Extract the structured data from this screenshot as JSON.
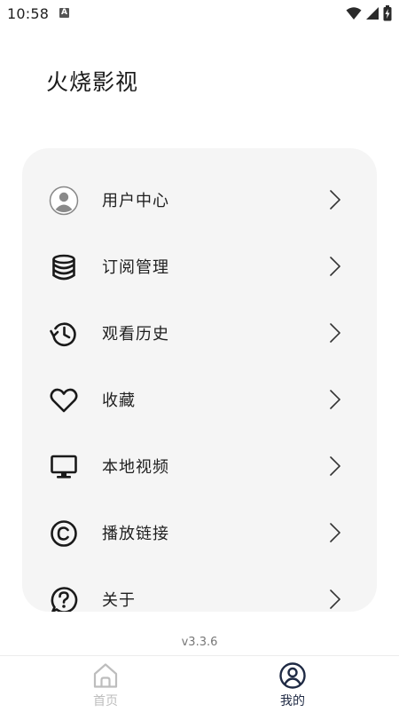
{
  "status_bar": {
    "time": "10:58",
    "notification_glyph": "A"
  },
  "header": {
    "app_title": "火烧影视"
  },
  "menu": {
    "items": [
      {
        "label": "用户中心",
        "icon": "user-avatar-icon"
      },
      {
        "label": "订阅管理",
        "icon": "database-icon"
      },
      {
        "label": "观看历史",
        "icon": "history-icon"
      },
      {
        "label": "收藏",
        "icon": "heart-icon"
      },
      {
        "label": "本地视频",
        "icon": "monitor-icon"
      },
      {
        "label": "播放链接",
        "icon": "copyright-icon"
      },
      {
        "label": "关于",
        "icon": "help-icon"
      }
    ]
  },
  "footer": {
    "version": "v3.3.6"
  },
  "bottom_nav": {
    "home_label": "首页",
    "mine_label": "我的",
    "active": "mine"
  },
  "colors": {
    "card_bg": "#f5f5f5",
    "active_nav": "#1f2a44",
    "inactive_nav": "#bdbdbd"
  }
}
